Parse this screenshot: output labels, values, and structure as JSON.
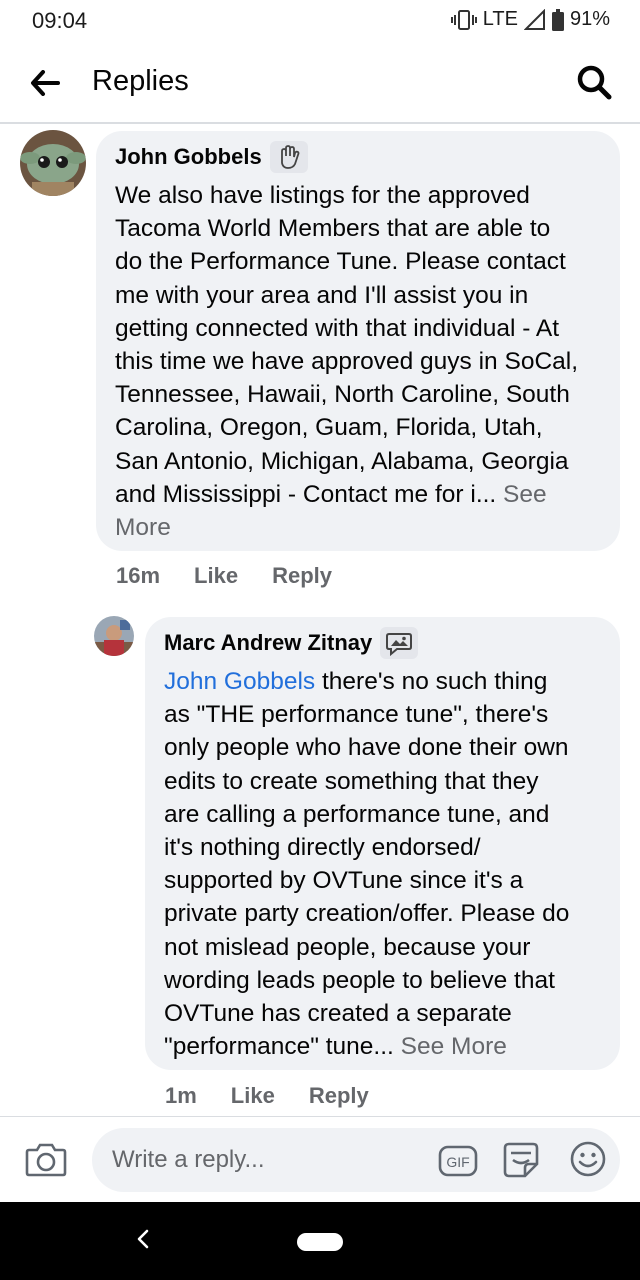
{
  "status_bar": {
    "time": "09:04",
    "network": "LTE",
    "battery": "91%"
  },
  "header": {
    "title": "Replies",
    "back_icon": "arrow-left-icon",
    "search_icon": "search-icon"
  },
  "comments": [
    {
      "author": "John Gobbels",
      "badge_icon": "hand-wave-icon",
      "text_lines": [
        "We also have listings for the approved",
        "Tacoma World Members that are able to",
        "do the Performance Tune. Please contact",
        "me with your area and I'll assist you in",
        "getting connected with that individual  - At",
        "this time we have approved guys in SoCal,",
        "Tennessee, Hawaii, North Caroline, South",
        "Carolina, Oregon, Guam, Florida, Utah,",
        "San Antonio, Michigan, Alabama, Georgia",
        "and Mississippi - Contact me for  i... "
      ],
      "see_more": "See",
      "see_more_2": "More",
      "time": "16m",
      "like": "Like",
      "reply": "Reply"
    },
    {
      "author": "Marc Andrew Zitnay",
      "badge_icon": "image-comment-icon",
      "mention": "John Gobbels",
      "first_line_rest": " there's no such thing",
      "text_lines": [
        "as \"THE performance tune\", there's",
        "only people who have done their own",
        "edits to create something that they",
        "are calling a performance tune, and",
        "it's nothing directly endorsed/",
        "supported by OVTune since it's a",
        "private party creation/offer. Please do",
        "not mislead people, because your",
        "wording leads people to believe that",
        "OVTune has created a separate",
        "\"performance\" tune... "
      ],
      "see_more": "See More",
      "time": "1m",
      "like": "Like",
      "reply": "Reply"
    }
  ],
  "composer": {
    "placeholder": "Write a reply...",
    "camera_icon": "camera-icon",
    "gif_label": "GIF",
    "sticker_icon": "sticker-icon",
    "emoji_icon": "emoji-icon"
  },
  "nav_bar": {
    "back_icon": "nav-back-icon",
    "home_icon": "nav-home-pill"
  }
}
